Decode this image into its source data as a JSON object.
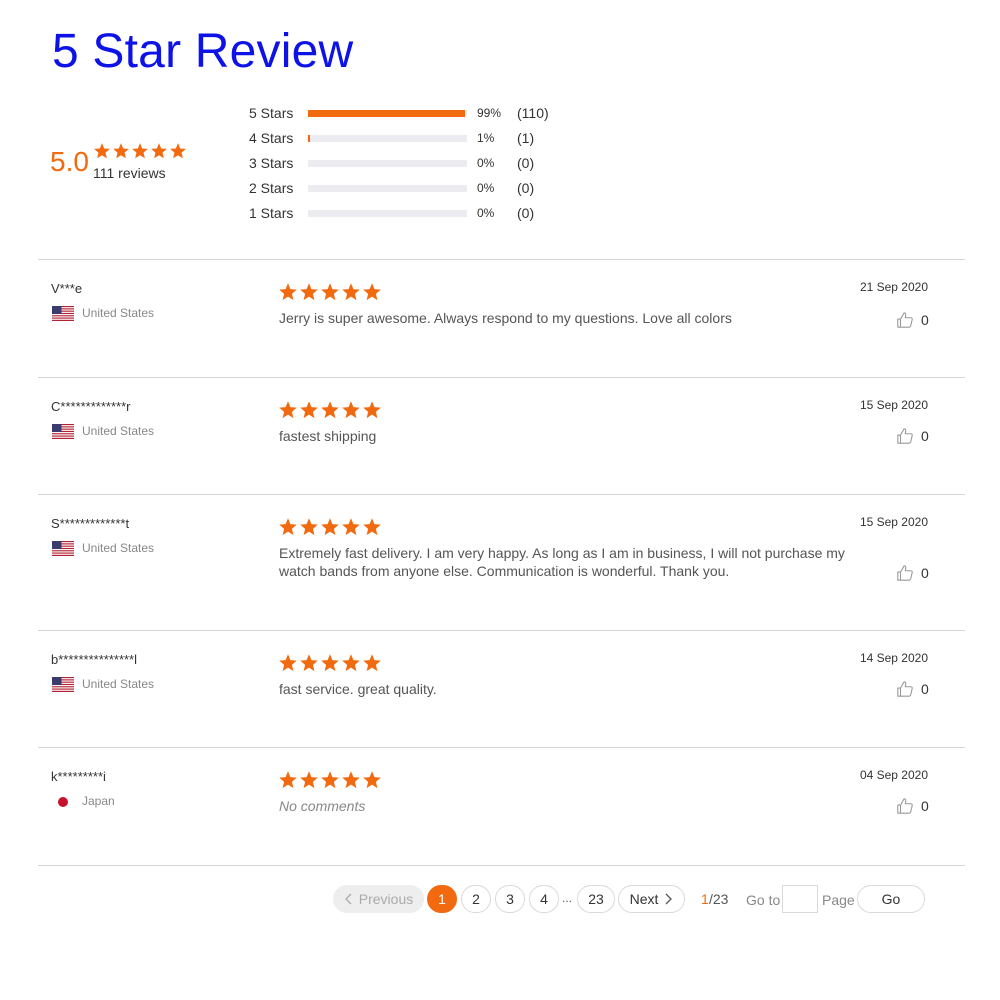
{
  "title": "5 Star Review",
  "summary": {
    "average": "5.0",
    "reviews_text": "111 reviews",
    "rating": 5
  },
  "accent_color": "#f26a10",
  "histogram": [
    {
      "label": "5  Stars",
      "pct_text": "99%",
      "count_text": "(110)",
      "fraction": 0.99
    },
    {
      "label": "4  Stars",
      "pct_text": "1%",
      "count_text": "(1)",
      "fraction": 0.01
    },
    {
      "label": "3  Stars",
      "pct_text": "0%",
      "count_text": "(0)",
      "fraction": 0
    },
    {
      "label": "2  Stars",
      "pct_text": "0%",
      "count_text": "(0)",
      "fraction": 0
    },
    {
      "label": "1  Stars",
      "pct_text": "0%",
      "count_text": "(0)",
      "fraction": 0
    }
  ],
  "reviews": [
    {
      "name": "V***e",
      "country": "United States",
      "flag": "us-flag-icon",
      "rating": 5,
      "text": "Jerry is super awesome. Always respond to my questions. Love all colors",
      "date": "21 Sep 2020",
      "likes": "0"
    },
    {
      "name": "C*************r",
      "country": "United States",
      "flag": "us-flag-icon",
      "rating": 5,
      "text": "fastest shipping",
      "date": "15 Sep 2020",
      "likes": "0"
    },
    {
      "name": "S*************t",
      "country": "United States",
      "flag": "us-flag-icon",
      "rating": 5,
      "text": "Extremely fast delivery.  I am very happy.  As long as I am in business, I will not purchase my watch bands from anyone else.  Communication is wonderful.  Thank you.",
      "date": "15 Sep 2020",
      "likes": "0"
    },
    {
      "name": "b***************l",
      "country": "United States",
      "flag": "us-flag-icon",
      "rating": 5,
      "text": "fast service. great quality.",
      "date": "14 Sep 2020",
      "likes": "0"
    },
    {
      "name": "k*********i",
      "country": "Japan",
      "flag": "jp-flag-icon",
      "rating": 5,
      "text": "No comments",
      "date": "04 Sep 2020",
      "likes": "0"
    }
  ],
  "pagination": {
    "previous_label": "Previous",
    "pages": [
      "1",
      "2",
      "3",
      "4"
    ],
    "ellipsis": "...",
    "last_page": "23",
    "next_label": "Next",
    "current": "1",
    "total": "/23",
    "goto_label": "Go to",
    "goto_value": "",
    "page_label": "Page",
    "go_label": "Go"
  }
}
